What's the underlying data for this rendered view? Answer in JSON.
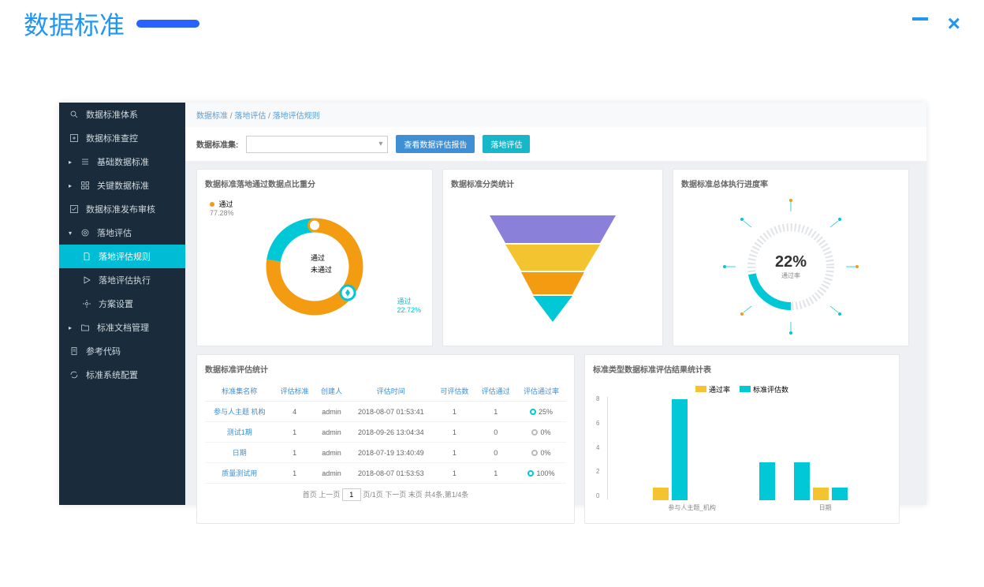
{
  "window": {
    "title": "数据标准",
    "minimize_label": "minimize",
    "close_label": "×"
  },
  "sidebar": {
    "items": [
      {
        "label": "数据标准体系",
        "icon": "search"
      },
      {
        "label": "数据标准查控",
        "icon": "plus-square"
      },
      {
        "label": "基础数据标准",
        "icon": "list",
        "caret": true
      },
      {
        "label": "关键数据标准",
        "icon": "grid",
        "caret": true
      },
      {
        "label": "数据标准发布审核",
        "icon": "check-square"
      },
      {
        "label": "落地评估",
        "icon": "target",
        "caret": true,
        "expanded": true
      },
      {
        "label": "落地评估规则",
        "icon": "file",
        "sub": true,
        "active": true
      },
      {
        "label": "落地评估执行",
        "icon": "play",
        "sub": true
      },
      {
        "label": "方案设置",
        "icon": "settings",
        "sub": true
      },
      {
        "label": "标准文档管理",
        "icon": "folder",
        "caret": true
      },
      {
        "label": "参考代码",
        "icon": "file-text"
      },
      {
        "label": "标准系统配置",
        "icon": "refresh"
      }
    ]
  },
  "breadcrumb": {
    "a": "数据标准",
    "b": "落地评估",
    "c": "落地评估规则"
  },
  "toolbar": {
    "label": "数据标准集:",
    "select_placeholder": "",
    "btn1": "查看数据评估报告",
    "btn2": "落地评估"
  },
  "panel_donut": {
    "title": "数据标准落地通过数据点比重分",
    "legend_top": "通过",
    "legend_top_val": "77.28%",
    "inner_legend": [
      "通过",
      "未通过"
    ],
    "callout_label": "通过",
    "callout_val": "22.72%"
  },
  "panel_funnel": {
    "title": "数据标准分类统计"
  },
  "panel_gauge": {
    "title": "数据标准总体执行进度率",
    "value": "22%",
    "sub": "通过率"
  },
  "panel_table": {
    "title": "数据标准评估统计",
    "columns": [
      "标准集名称",
      "评估标准",
      "创建人",
      "评估时间",
      "可评估数",
      "评估通过",
      "评估通过率"
    ],
    "rows": [
      {
        "name": "参与人主题 机构",
        "c1": "4",
        "creator": "admin",
        "time": "2018-08-07 01:53:41",
        "a": "1",
        "b": "1",
        "rate": "25%",
        "color": "#00c8d6"
      },
      {
        "name": "测试1期",
        "c1": "1",
        "creator": "admin",
        "time": "2018-09-26 13:04:34",
        "a": "1",
        "b": "0",
        "rate": "0%",
        "color": "#bbb"
      },
      {
        "name": "日期",
        "c1": "1",
        "creator": "admin",
        "time": "2018-07-19 13:40:49",
        "a": "1",
        "b": "0",
        "rate": "0%",
        "color": "#bbb"
      },
      {
        "name": "质量测试用",
        "c1": "1",
        "creator": "admin",
        "time": "2018-08-07 01:53:53",
        "a": "1",
        "b": "1",
        "rate": "100%",
        "color": "#00c8d6"
      }
    ],
    "pager_prefix": "首页 上一页 ",
    "pager_page": "1",
    "pager_mid": " 页/1页 下一页 末页  共4条,第1/4条"
  },
  "panel_bar": {
    "title": "标准类型数据标准评估结果统计表",
    "legend": [
      "通过率",
      "标准评估数"
    ],
    "yticks": [
      "8",
      "6",
      "4",
      "2",
      "0"
    ],
    "categories": [
      "参与人主题_机构",
      "日期"
    ]
  },
  "chart_data": [
    {
      "type": "pie",
      "title": "数据标准落地通过数据点比重分",
      "series": [
        {
          "name": "通过",
          "value": 77.28
        },
        {
          "name": "未通过",
          "value": 22.72
        }
      ],
      "colors": [
        "#f39c12",
        "#00c8d6"
      ]
    },
    {
      "type": "funnel",
      "title": "数据标准分类统计",
      "stages": [
        {
          "name": "stage1",
          "color": "#8a7fd9"
        },
        {
          "name": "stage2",
          "color": "#f4c430"
        },
        {
          "name": "stage3",
          "color": "#f39c12"
        },
        {
          "name": "stage4",
          "color": "#00c8d6"
        }
      ]
    },
    {
      "type": "gauge",
      "title": "数据标准总体执行进度率",
      "value": 22,
      "max": 100,
      "label": "通过率"
    },
    {
      "type": "bar",
      "title": "标准类型数据标准评估结果统计表",
      "categories": [
        "参与人主题_机构",
        "日期"
      ],
      "series": [
        {
          "name": "通过率",
          "values": [
            1,
            1
          ],
          "color": "#f4c430"
        },
        {
          "name": "标准评估数",
          "values": [
            8,
            3
          ],
          "color": "#00c8d6"
        },
        {
          "name": "extra1",
          "values": [
            0,
            3
          ],
          "color": "#00c8d6"
        },
        {
          "name": "extra2",
          "values": [
            0,
            1
          ],
          "color": "#f4c430"
        },
        {
          "name": "extra3",
          "values": [
            0,
            1
          ],
          "color": "#00c8d6"
        }
      ],
      "ylim": [
        0,
        8
      ]
    }
  ]
}
